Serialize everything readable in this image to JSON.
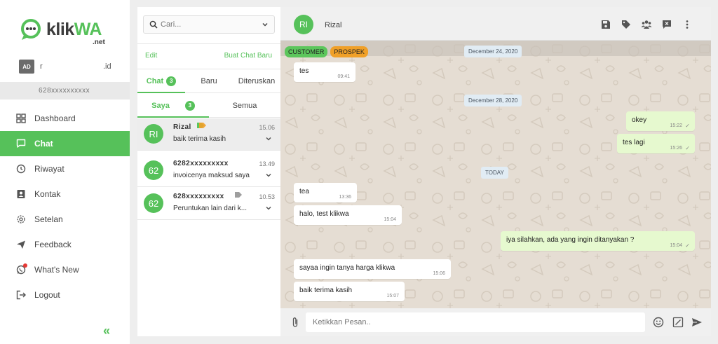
{
  "brand": {
    "name_dark": "klik",
    "name_green": "WA",
    "suffix": ".net"
  },
  "user": {
    "avatar": "AD",
    "name": "r",
    "domain": ".id",
    "phone": "628xxxxxxxxxx"
  },
  "nav": [
    {
      "label": "Dashboard",
      "icon": "dashboard-icon",
      "active": false
    },
    {
      "label": "Chat",
      "icon": "chat-icon",
      "active": true
    },
    {
      "label": "Riwayat",
      "icon": "history-icon",
      "active": false
    },
    {
      "label": "Kontak",
      "icon": "contact-icon",
      "active": false
    },
    {
      "label": "Setelan",
      "icon": "gear-icon",
      "active": false
    },
    {
      "label": "Feedback",
      "icon": "send-icon",
      "active": false
    },
    {
      "label": "What's New",
      "icon": "whatsapp-icon",
      "active": false
    },
    {
      "label": "Logout",
      "icon": "logout-icon",
      "active": false
    }
  ],
  "chatlist": {
    "search_placeholder": "Cari...",
    "edit": "Edit",
    "new_chat": "Buat Chat Baru",
    "tabs": [
      {
        "label": "Chat",
        "badge": "3"
      },
      {
        "label": "Baru"
      },
      {
        "label": "Diteruskan"
      }
    ],
    "subtabs": [
      {
        "label": "Saya",
        "badge": "3"
      },
      {
        "label": "Semua"
      }
    ],
    "items": [
      {
        "avatar": "RI",
        "name": "Rizal",
        "time": "15.06",
        "message": "baik terima kasih"
      },
      {
        "avatar": "62",
        "name": "6282xxxxxxxxx",
        "time": "13.49",
        "message": "invoicenya maksud saya"
      },
      {
        "avatar": "62",
        "name": "628xxxxxxxxx",
        "time": "10.53",
        "message": "Peruntukan lain dari k..."
      }
    ]
  },
  "conversation": {
    "avatar": "RI",
    "name": "Rizal",
    "labels": [
      {
        "text": "CUSTOMER",
        "color": "#5cc65c"
      },
      {
        "text": "PROSPEK",
        "color": "#f0a028"
      }
    ],
    "dates": [
      "December 24, 2020",
      "December 28, 2020",
      "TODAY"
    ],
    "messages": [
      {
        "text": "tes",
        "time": "09:41",
        "dir": "in"
      },
      {
        "text": "okey",
        "time": "15:22",
        "dir": "out"
      },
      {
        "text": "tes lagi",
        "time": "15:26",
        "dir": "out"
      },
      {
        "text": "tea",
        "time": "13:36",
        "dir": "in"
      },
      {
        "text": "halo, test klikwa",
        "time": "15:04",
        "dir": "in"
      },
      {
        "text": "iya silahkan, ada yang ingin ditanyakan ?",
        "time": "15:04",
        "dir": "out"
      },
      {
        "text": "sayaa ingin tanya harga klikwa",
        "time": "15:06",
        "dir": "in"
      },
      {
        "text": "baik terima kasih",
        "time": "15:07",
        "dir": "in"
      }
    ],
    "input_placeholder": "Ketikkan Pesan.."
  },
  "colors": {
    "accent": "#56c15a",
    "chat_bg": "#e5ddd3",
    "outgoing": "#e6f9cf",
    "date_chip": "#e1ecf4"
  }
}
